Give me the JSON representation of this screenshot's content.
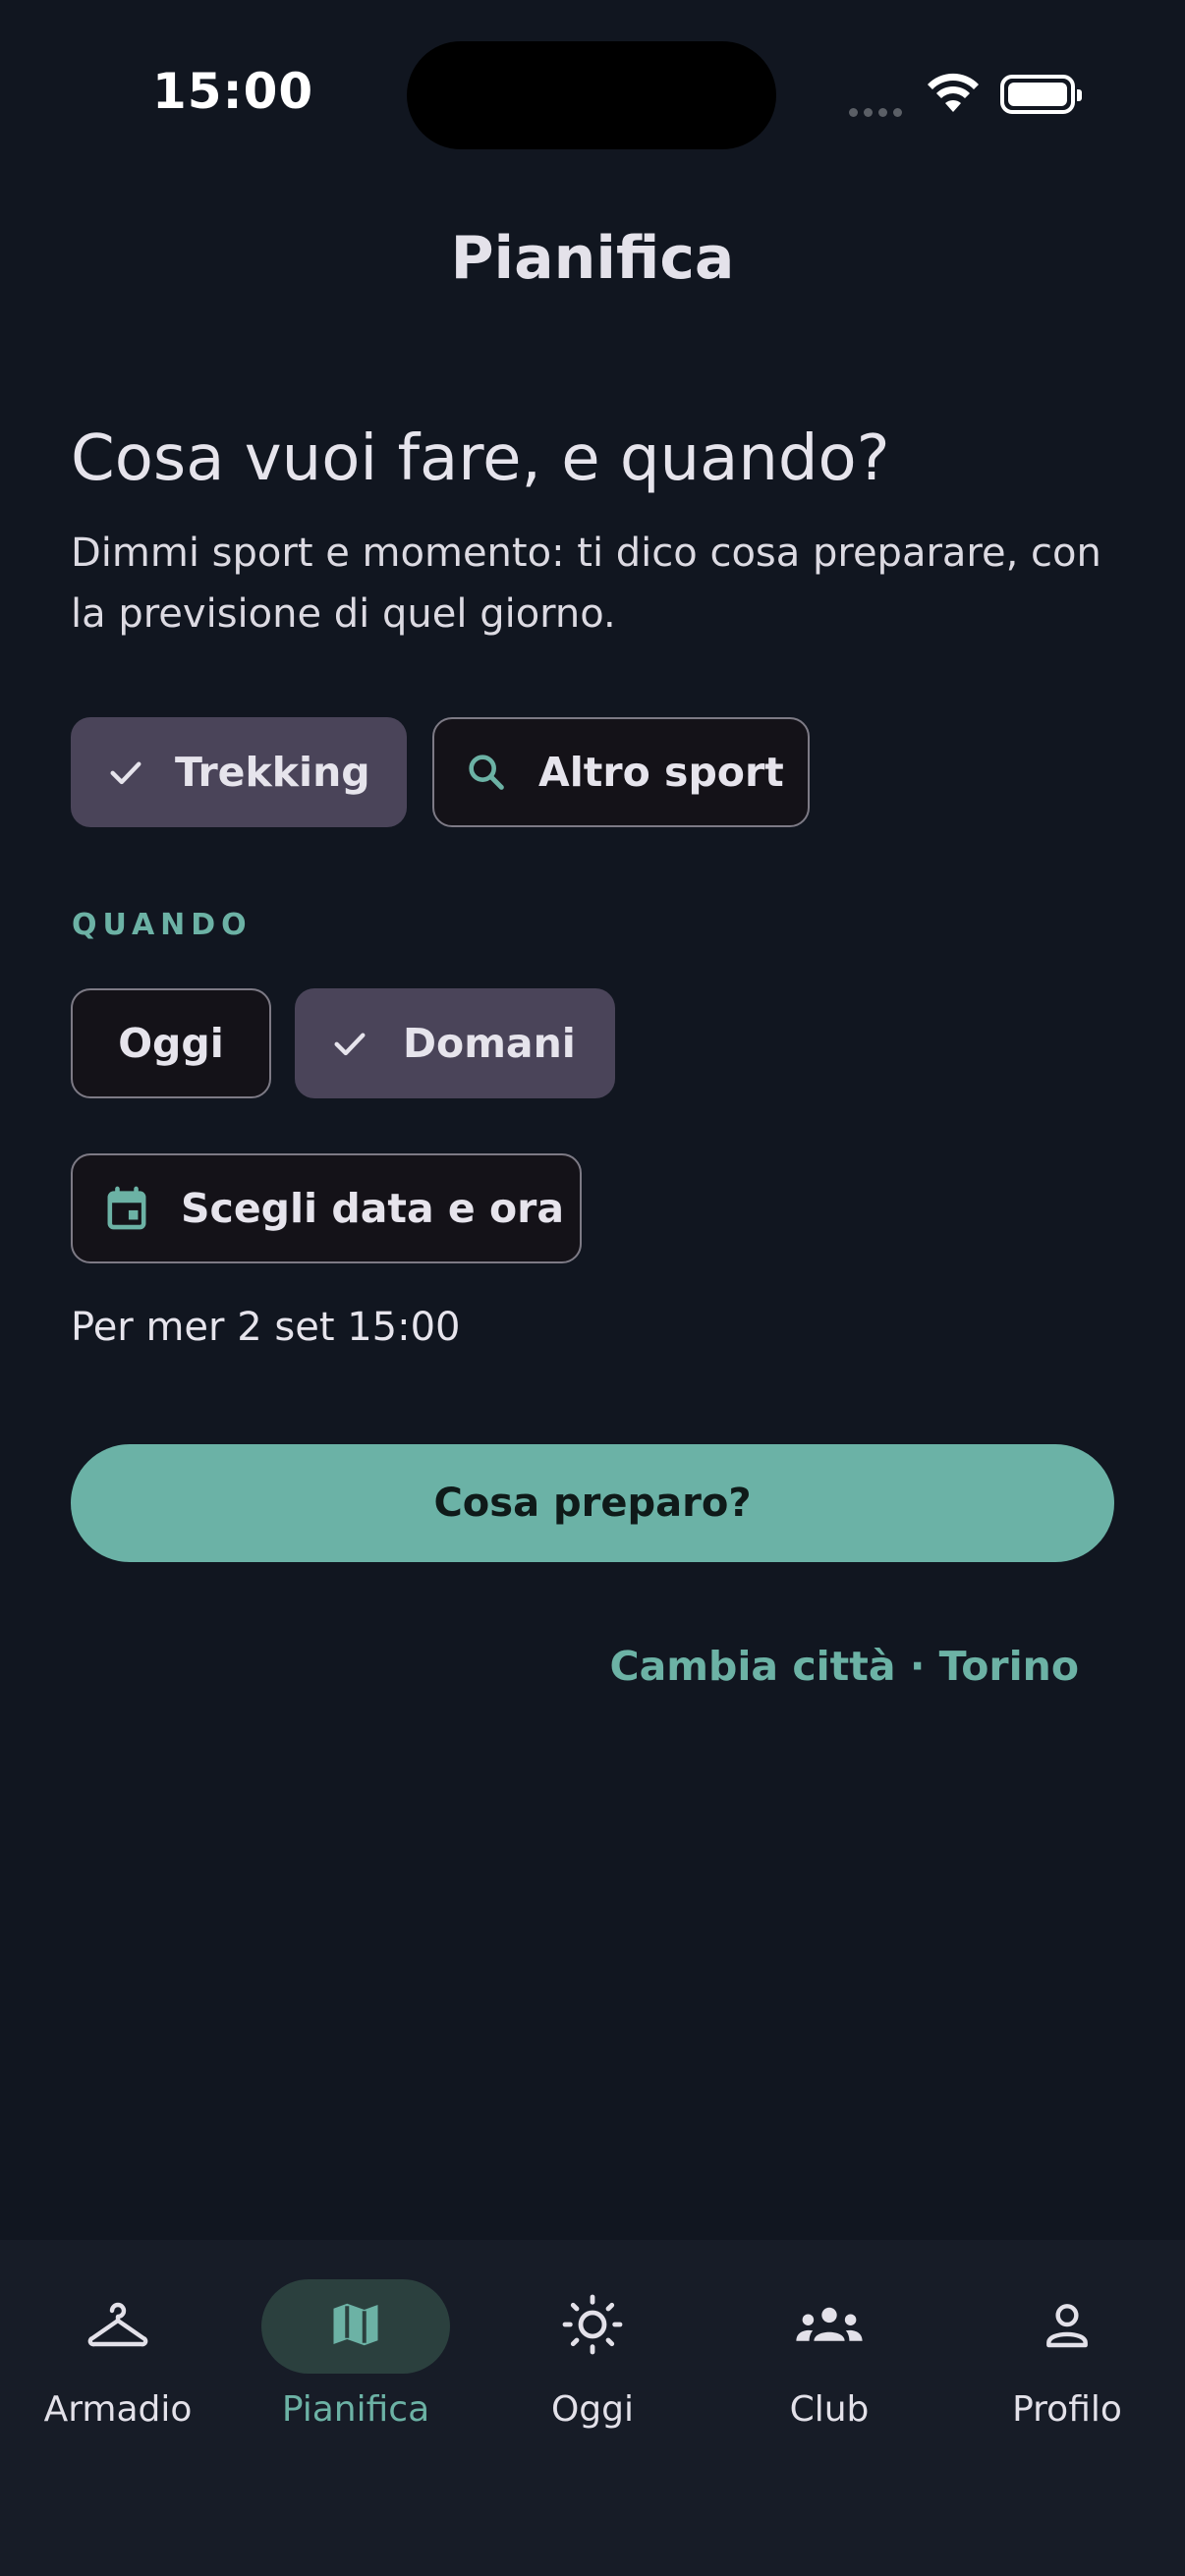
{
  "status_bar": {
    "time": "15:00"
  },
  "header": {
    "title": "Pianifica"
  },
  "intro": {
    "heading": "Cosa vuoi fare, e quando?",
    "subtitle": "Dimmi sport e momento: ti dico cosa preparare, con la previsione di quel giorno."
  },
  "sport": {
    "chips": [
      {
        "label": "Trekking",
        "selected": true,
        "icon": "check-icon"
      },
      {
        "label": "Altro sport",
        "selected": false,
        "icon": "search-icon"
      }
    ]
  },
  "when": {
    "section_label": "QUANDO",
    "chips": [
      {
        "label": "Oggi",
        "selected": false
      },
      {
        "label": "Domani",
        "selected": true,
        "icon": "check-icon"
      }
    ],
    "date_button": {
      "label": "Scegli data e ora",
      "icon": "calendar-icon"
    },
    "selected_date": "Per mer 2 set 15:00"
  },
  "cta": {
    "label": "Cosa preparo?"
  },
  "city": {
    "link": "Cambia città · Torino"
  },
  "nav": {
    "items": [
      {
        "label": "Armadio",
        "icon": "hanger-icon",
        "active": false
      },
      {
        "label": "Pianifica",
        "icon": "map-icon",
        "active": true
      },
      {
        "label": "Oggi",
        "icon": "sun-icon",
        "active": false
      },
      {
        "label": "Club",
        "icon": "group-icon",
        "active": false
      },
      {
        "label": "Profilo",
        "icon": "person-icon",
        "active": false
      }
    ]
  },
  "colors": {
    "background": "#111620",
    "accent": "#6BB2A6",
    "chip_selected": "#4A4459",
    "chip_outlined_bg": "#141218",
    "navbar": "#171C27"
  }
}
